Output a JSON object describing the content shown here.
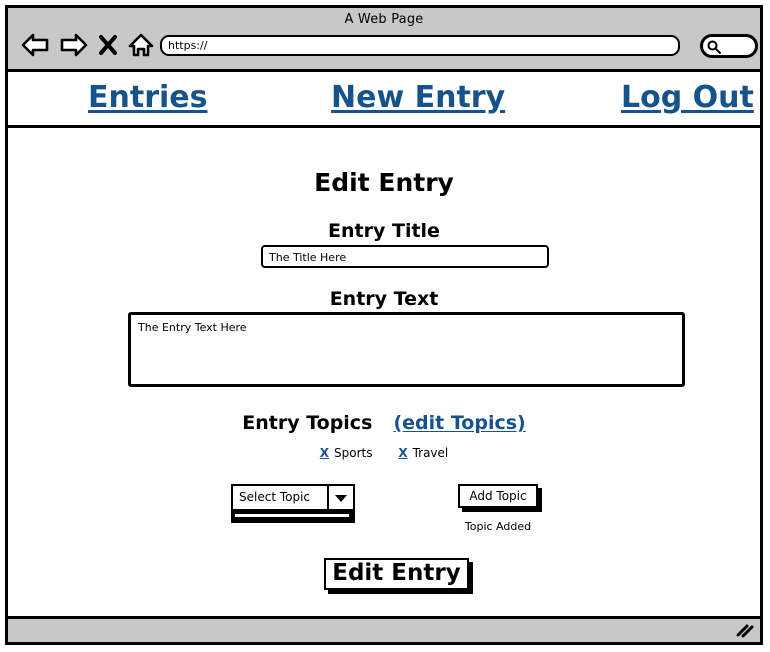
{
  "browser": {
    "window_title": "A Web Page",
    "url_value": "https://",
    "search_value": "",
    "icons": {
      "back": "back-arrow-icon",
      "forward": "forward-arrow-icon",
      "stop": "close-x-icon",
      "home": "home-icon",
      "search": "search-icon",
      "resize": "resize-grip-icon"
    }
  },
  "nav": {
    "entries": "Entries",
    "new_entry": "New Entry",
    "log_out": "Log Out"
  },
  "main": {
    "page_title": "Edit Entry",
    "title_label": "Entry Title",
    "title_value": "The Title Here",
    "text_label": "Entry Text",
    "text_value": "The Entry Text Here",
    "topics_label": "Entry Topics",
    "edit_topics_link": "(edit Topics)",
    "topics": [
      {
        "remove": "X",
        "name": "Sports"
      },
      {
        "remove": "X",
        "name": "Travel"
      }
    ],
    "select_topic_value": "Select Topic",
    "add_topic_label": "Add Topic",
    "status_message": "Topic Added",
    "submit_label": "Edit Entry"
  },
  "colors": {
    "link": "#16538c",
    "chrome": "#c8c8c8",
    "ink": "#000000",
    "page": "#ffffff"
  }
}
